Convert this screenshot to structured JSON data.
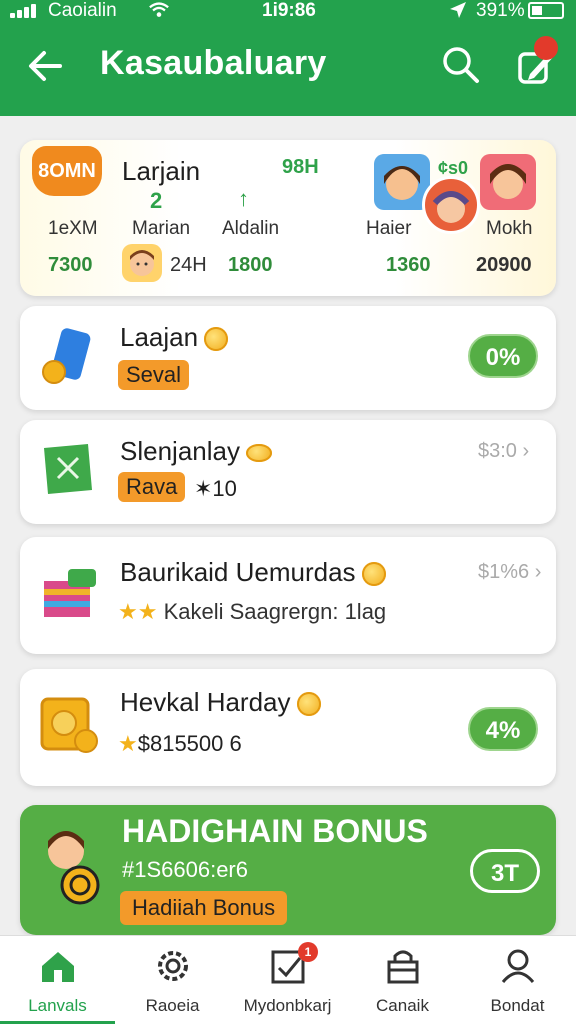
{
  "status": {
    "carrier": "Caoialin",
    "time": "1i9:86",
    "battery": "391%"
  },
  "header": {
    "title": "Kasaubaluary"
  },
  "cards": [
    {
      "tag": "8OMN",
      "title": "Larjain",
      "extra": "98H",
      "values": {
        "v2": "2",
        "arrow": "↑"
      },
      "labels": [
        "1eXM",
        "Marian",
        "Aldalin",
        "Haier",
        "Mokh"
      ],
      "numbers": [
        "7300",
        "24H",
        "1800",
        "1360",
        "20900"
      ],
      "price": "¢s0"
    },
    {
      "title": "Laajan",
      "badge": "Seval",
      "pill": "0%"
    },
    {
      "title": "Slenjanlay",
      "badge": "Rava",
      "badge_extra": "✶10",
      "price": "$3:0 ›"
    },
    {
      "title": "Baurikaid Uemurdas",
      "sub": "Kakeli Saagrergn: 1lag",
      "price": "$1%6 ›"
    },
    {
      "title": "Hevkal Harday",
      "sub": "$815500 6",
      "pill": "4%"
    },
    {
      "title": "HADIGHAIN BONUS",
      "sub": "#1S6606:er6",
      "badge": "Hadiiah Bonus",
      "pill": "3T"
    }
  ],
  "nav": [
    {
      "label": "Lanvals",
      "icon": "home-icon"
    },
    {
      "label": "Raoeia",
      "icon": "gear-icon"
    },
    {
      "label": "Mydonbkarj",
      "icon": "checklist-icon",
      "badge": "1"
    },
    {
      "label": "Canaik",
      "icon": "bag-icon"
    },
    {
      "label": "Bondat",
      "icon": "person-icon"
    }
  ],
  "colors": {
    "brand": "#23a24d",
    "accent": "#f39a2a",
    "pill": "#55ae45"
  }
}
